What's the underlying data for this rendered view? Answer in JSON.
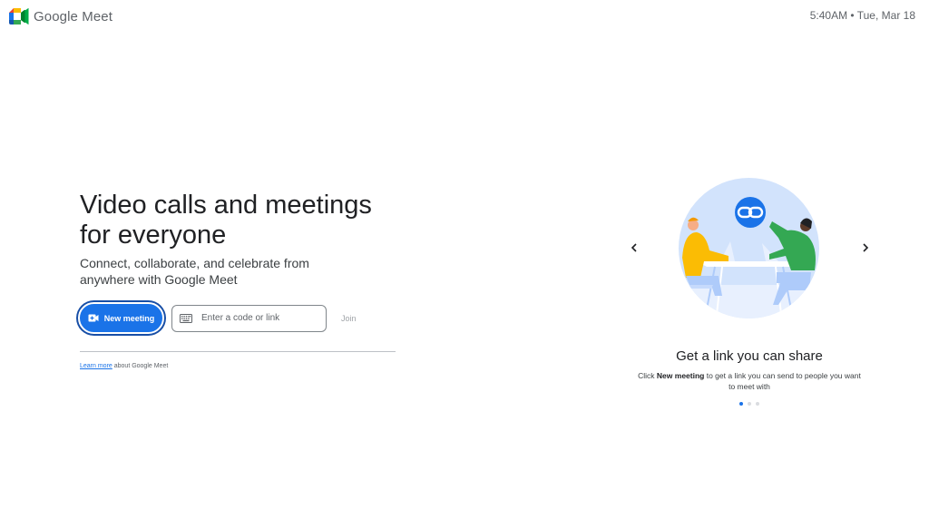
{
  "header": {
    "app_name": "Google Meet",
    "datetime": "5:40AM • Tue, Mar 18"
  },
  "hero": {
    "headline": "Video calls and meetings\nfor everyone",
    "subhead": "Connect, collaborate, and celebrate from\nanywhere with Google Meet"
  },
  "actions": {
    "new_meeting_label": "New meeting",
    "code_placeholder": "Enter a code or link",
    "join_label": "Join"
  },
  "footer": {
    "learn_more_link": "Learn more",
    "learn_more_suffix": " about Google Meet"
  },
  "carousel": {
    "slide_title": "Get a link you can share",
    "desc_prefix": "Click ",
    "desc_bold": "New meeting",
    "desc_suffix": " to get a link you can send to people you want to meet with",
    "dots": 3,
    "active_dot": 0
  },
  "colors": {
    "accent": "#1a73e8",
    "illustration_bg": "#d2e3fc"
  },
  "icons": {
    "logo": "google-meet-logo",
    "new_meeting": "video-plus-icon",
    "code_field": "keyboard-icon",
    "prev": "chevron-left-icon",
    "next": "chevron-right-icon",
    "link": "link-icon"
  }
}
